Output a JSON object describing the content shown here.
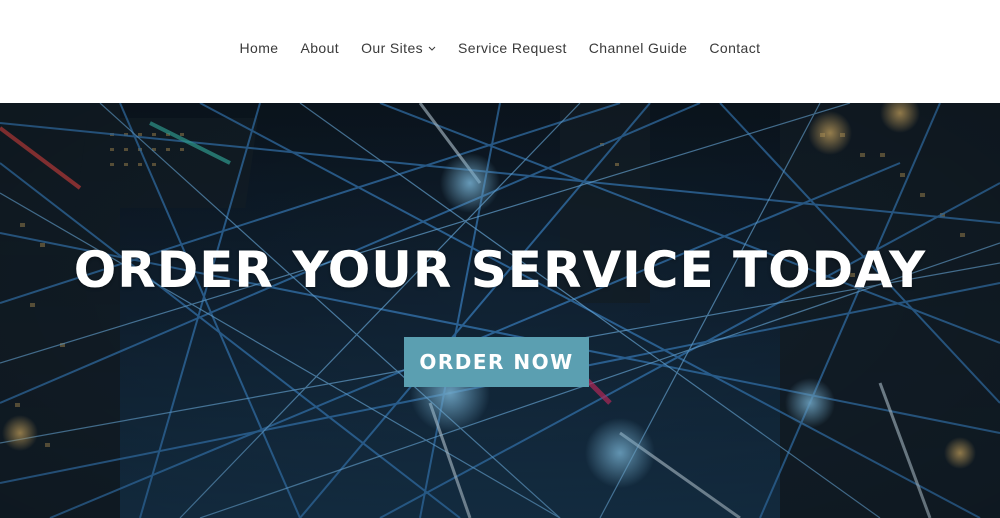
{
  "nav": {
    "items": [
      {
        "label": "Home",
        "dropdown": false
      },
      {
        "label": "About",
        "dropdown": false
      },
      {
        "label": "Our Sites",
        "dropdown": true
      },
      {
        "label": "Service Request",
        "dropdown": false
      },
      {
        "label": "Channel Guide",
        "dropdown": false
      },
      {
        "label": "Contact",
        "dropdown": false
      }
    ]
  },
  "hero": {
    "title": "ORDER YOUR SERVICE TODAY",
    "button_label": "ORDER NOW",
    "button_color": "#5b9fb1",
    "background_theme": "network-lines-city-night"
  }
}
